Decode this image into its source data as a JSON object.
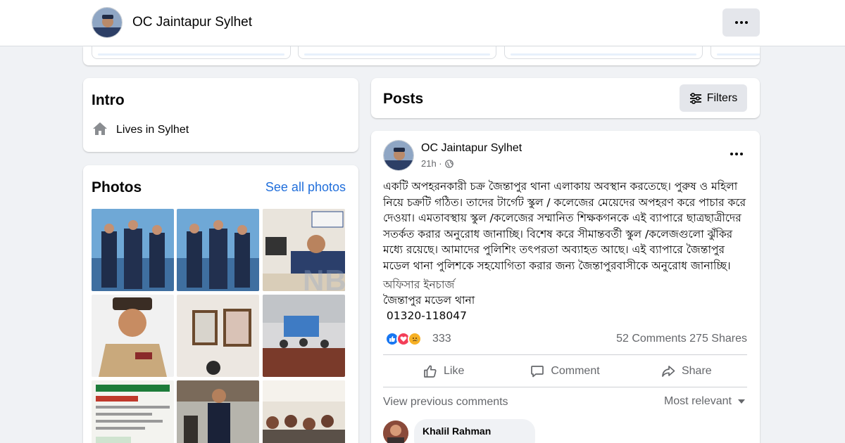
{
  "header": {
    "page_name": "OC Jaintapur Sylhet",
    "more_icon": "more-horizontal-icon"
  },
  "intro": {
    "title": "Intro",
    "lives_prefix": "Lives in",
    "lives_place": "Sylhet",
    "icon": "home-icon"
  },
  "photos": {
    "title": "Photos",
    "see_all": "See all photos"
  },
  "posts": {
    "title": "Posts",
    "filters_label": "Filters",
    "filters_icon": "sliders-icon"
  },
  "post": {
    "author": "OC Jaintapur Sylhet",
    "time": "21h ·",
    "privacy_icon": "globe-icon",
    "body": "একটি অপহরনকারী চক্র জৈন্তাপুর থানা এলাকায় অবস্থান করতেছে। পুরুষ ও মহিলা নিয়ে চক্রটি গঠিত। তাদের টার্গেট স্কুল / কলেজের মেয়েদের অপহরণ করে পাচার করে দেওয়া। এমতাবস্থায় স্কুল /কলেজের সম্মানিত শিক্ষকগনকে এই ব্যাপারে ছাত্রছাত্রীদের সতর্কত করার অনুরোধ জানাচ্ছি। বিশেষ করে সীমান্তবর্তী স্কুল /কলেজগুলো ঝুঁকির মধ্যে রয়েছে। আমাদের পুলিশিং তৎপরতা অব্যাহত আছে। এই ব্যাপারে জৈন্তাপুর মডেল থানা পুলিশকে সহযোগিতা করার জন্য জৈন্তাপুরবাসীকে অনুরোধ জানাচ্ছি।",
    "signature": [
      "অফিসার ইনচার্জ",
      "জৈন্তাপুর মডেল থানা",
      " 01320-118047"
    ],
    "reaction_count": "333",
    "comments": "52 Comments",
    "shares": "275 Shares",
    "actions": {
      "like": "Like",
      "comment": "Comment",
      "share": "Share"
    },
    "view_previous": "View previous comments",
    "most_relevant": "Most relevant",
    "first_commenter": "Khalil Rahman"
  },
  "watermark": "NB",
  "colors": {
    "link": "#216fdb",
    "muted": "#65676b",
    "like_blue": "#1877f2",
    "love_red": "#f33e58",
    "sad_yellow": "#f7b125"
  }
}
